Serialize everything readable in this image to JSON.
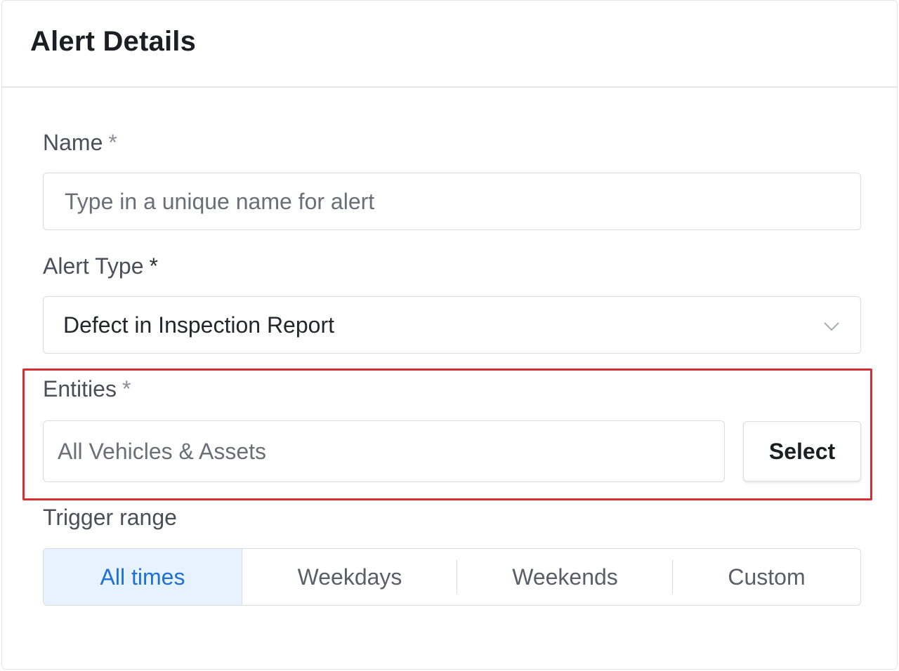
{
  "header": {
    "title": "Alert Details"
  },
  "form": {
    "name": {
      "label": "Name",
      "required_mark": "*",
      "placeholder": "Type in a unique name for alert"
    },
    "alert_type": {
      "label": "Alert Type",
      "required_mark": "*",
      "value": "Defect in Inspection Report"
    },
    "entities": {
      "label": "Entities",
      "required_mark": "*",
      "value": "All Vehicles & Assets",
      "button_label": "Select"
    },
    "trigger_range": {
      "label": "Trigger range",
      "options": [
        "All times",
        "Weekdays",
        "Weekends",
        "Custom"
      ],
      "selected": "All times"
    }
  },
  "colors": {
    "highlight_border": "#d32f35",
    "active_segment_bg": "#e6f3fe",
    "active_segment_text": "#1f6fd6"
  },
  "icons": {
    "dropdown": "chevron-down-icon"
  }
}
